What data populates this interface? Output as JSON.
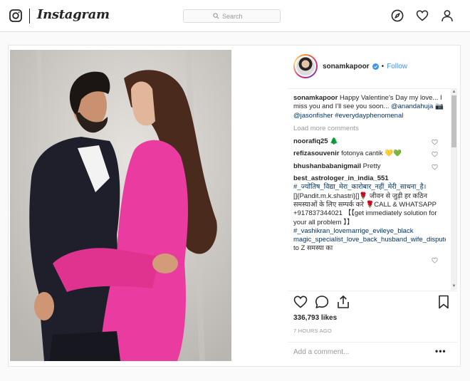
{
  "header": {
    "brand": "Instagram",
    "search_placeholder": "Search",
    "icons": [
      "instagram-logo-icon",
      "search-icon",
      "compass-icon",
      "heart-icon",
      "profile-icon"
    ]
  },
  "post": {
    "author": "sonamkapoor",
    "verified": true,
    "separator": "•",
    "follow_label": "Follow",
    "caption": {
      "username": "sonamkapoor",
      "text": "Happy Valentine's Day my love... I miss you and I'll see you soon...",
      "mention_1": "@anandahuja",
      "emoji": "📷",
      "mention_2": "@jasonfisher",
      "hashtag": "#everydayphenomenal"
    },
    "load_more_label": "Load more comments",
    "comments": [
      {
        "username": "noorafiq25",
        "text": "",
        "emoji": "🌲"
      },
      {
        "username": "refizasouvenir",
        "text": "fotonya cantik",
        "emoji": "💛💚"
      },
      {
        "username": "bhushanbabanigmail",
        "text": "Pretty"
      },
      {
        "username": "best_astrologer_in_india_551",
        "hashtag_1": "#_ज्योतिष_विद्या_मेरा_कारोबार_नहीं_मेरी_साधना_है।",
        "body": "[]{Pandit.m.k.shastri}[]🌹 जीवन से जुड़ी हर कठिन समस्याओं के लिए सम्पर्क करे 🌹CALL & WHATSAPP +917837344021 【【get immediately solution for your all problem 】】",
        "hashtag_2": "#_vashikran_lovemarrige_evileye_black magic_specialist_love_back_husband_wife_dispute_problem_A",
        "tail": "to Z समस्या का"
      }
    ],
    "likes": "336,793 likes",
    "timestamp": "7 HOURS AGO",
    "add_comment_placeholder": "Add a comment...",
    "more_label": "•••"
  },
  "colors": {
    "link": "#003569",
    "accent": "#3897f0",
    "muted": "#999999"
  }
}
